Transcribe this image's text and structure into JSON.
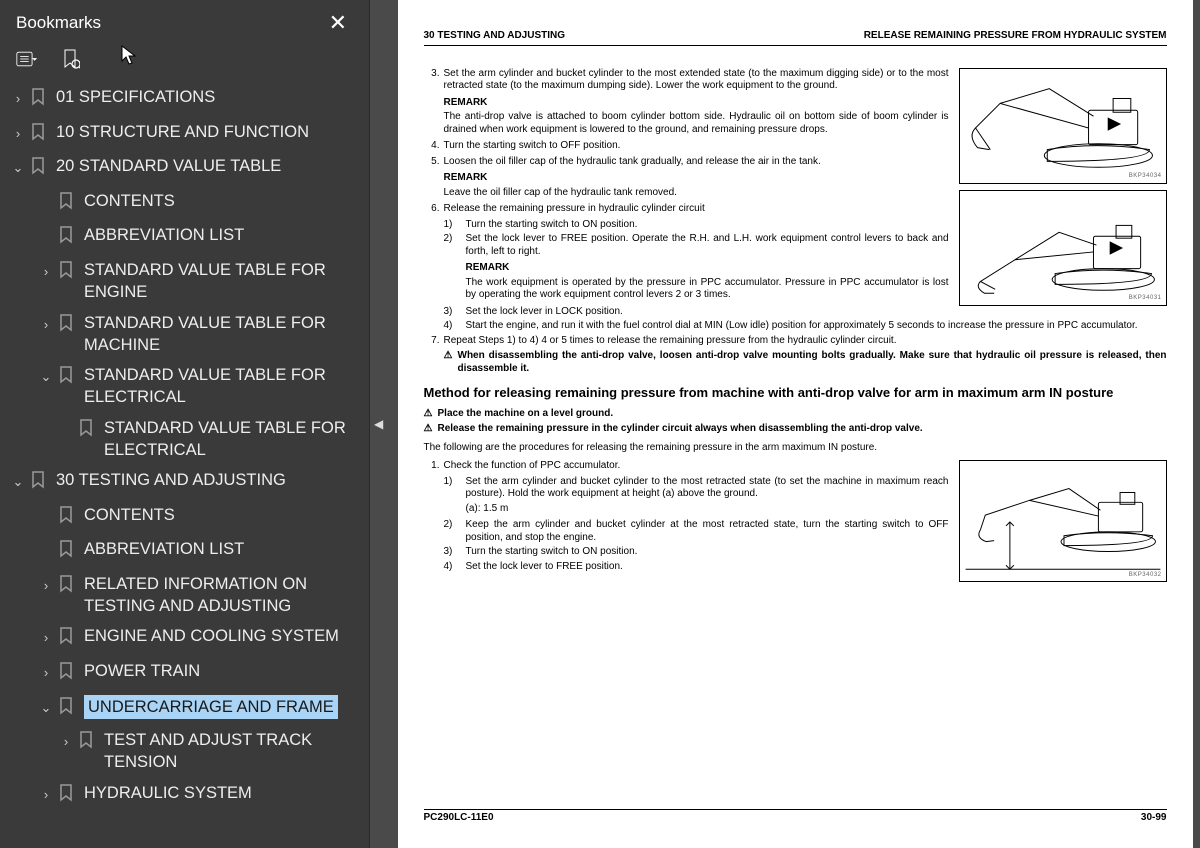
{
  "sidebar": {
    "title": "Bookmarks",
    "tree": [
      {
        "depth": 1,
        "chev": "›",
        "label": "01 SPECIFICATIONS"
      },
      {
        "depth": 1,
        "chev": "›",
        "label": "10 STRUCTURE AND FUNCTION"
      },
      {
        "depth": 1,
        "chev": "⌄",
        "label": "20 STANDARD VALUE TABLE"
      },
      {
        "depth": 2,
        "chev": "",
        "label": "CONTENTS"
      },
      {
        "depth": 2,
        "chev": "",
        "label": "ABBREVIATION LIST"
      },
      {
        "depth": 2,
        "chev": "›",
        "label": "STANDARD VALUE TABLE FOR ENGINE"
      },
      {
        "depth": 2,
        "chev": "›",
        "label": "STANDARD VALUE TABLE FOR MACHINE"
      },
      {
        "depth": 2,
        "chev": "⌄",
        "label": "STANDARD VALUE TABLE FOR ELECTRICAL"
      },
      {
        "depth": 3,
        "chev": "",
        "label": "STANDARD VALUE TABLE FOR ELECTRICAL"
      },
      {
        "depth": 1,
        "chev": "⌄",
        "label": "30 TESTING AND ADJUSTING"
      },
      {
        "depth": 2,
        "chev": "",
        "label": "CONTENTS"
      },
      {
        "depth": 2,
        "chev": "",
        "label": "ABBREVIATION LIST"
      },
      {
        "depth": 2,
        "chev": "›",
        "label": "RELATED INFORMATION ON TESTING AND ADJUSTING"
      },
      {
        "depth": 2,
        "chev": "›",
        "label": "ENGINE AND COOLING SYSTEM"
      },
      {
        "depth": 2,
        "chev": "›",
        "label": "POWER TRAIN"
      },
      {
        "depth": 2,
        "chev": "⌄",
        "label": "UNDERCARRIAGE AND FRAME",
        "selected": true
      },
      {
        "depth": 3,
        "chev": "›",
        "label": "TEST AND ADJUST TRACK TENSION"
      },
      {
        "depth": 2,
        "chev": "›",
        "label": "HYDRAULIC SYSTEM"
      }
    ]
  },
  "page": {
    "header_left": "30 TESTING AND ADJUSTING",
    "header_right": "RELEASE REMAINING PRESSURE FROM HYDRAULIC SYSTEM",
    "footer_left": "PC290LC-11E0",
    "footer_right": "30-99",
    "fig1_cap": "BKP34034",
    "fig2_cap": "BKP34031",
    "fig3_cap": "BKP34032",
    "step3": "Set the arm cylinder and bucket cylinder to the most extended state (to the maximum digging side) or to the most retracted state (to the maximum dumping side). Lower the work equipment to the ground.",
    "remark1_h": "REMARK",
    "remark1": "The anti-drop valve is attached to boom cylinder bottom side. Hydraulic oil on bottom side of boom cylinder is drained when work equipment is lowered to the ground, and remaining pressure drops.",
    "step4": "Turn the starting switch to OFF position.",
    "step5": "Loosen the oil filler cap of the hydraulic tank gradually, and release the air in the tank.",
    "remark2_h": "REMARK",
    "remark2": "Leave the oil filler cap of the hydraulic tank removed.",
    "step6": "Release the remaining pressure in hydraulic cylinder circuit",
    "s6_1": "Turn the starting switch to ON position.",
    "s6_2": "Set the lock lever to FREE position. Operate the R.H. and L.H. work equipment control levers to back and forth, left to right.",
    "remark3_h": "REMARK",
    "remark3": "The work equipment is operated by the pressure in PPC accumulator. Pressure in PPC accumulator is lost by operating the work equipment control levers 2 or 3 times.",
    "s6_3": "Set the lock lever in LOCK position.",
    "s6_4": "Start the engine, and run it with the fuel control dial at MIN (Low idle) position for approximately 5 seconds to increase the pressure in PPC accumulator.",
    "step7": "Repeat Steps 1) to 4) 4 or 5 times to release the remaining pressure from the hydraulic cylinder circuit.",
    "warn1": "When disassembling the anti-drop valve, loosen anti-drop valve mounting bolts gradually. Make sure that hydraulic oil pressure is released, then disassemble it.",
    "section_h": "Method for releasing remaining pressure from machine with anti-drop valve for arm in maximum arm IN posture",
    "warn2": "Place the machine on a level ground.",
    "warn3": "Release the remaining pressure in the cylinder circuit always when disassembling the anti-drop valve.",
    "following": "The following are the procedures for releasing the remaining pressure in the arm maximum IN posture.",
    "b_step1": "Check the function of PPC accumulator.",
    "b_s1": "Set the arm cylinder and bucket cylinder to the most retracted state (to set the machine in maximum reach posture). Hold the work equipment at height (a) above the ground.",
    "b_a": "(a): 1.5 m",
    "b_s2": "Keep the arm cylinder and bucket cylinder at the most retracted state, turn the starting switch to OFF position, and stop the engine.",
    "b_s3": "Turn the starting switch to ON position.",
    "b_s4": "Set the lock lever to FREE position."
  }
}
